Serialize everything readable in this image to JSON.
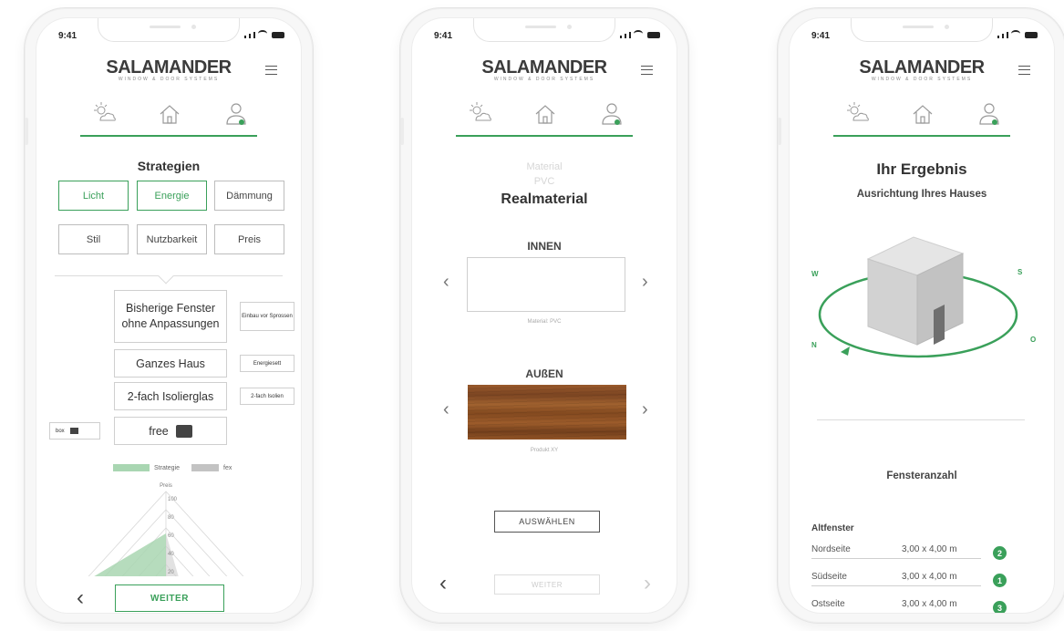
{
  "status": {
    "time": "9:41"
  },
  "brand": {
    "name": "SALAMANDER",
    "tagline": "WINDOW & DOOR SYSTEMS"
  },
  "icons": {
    "step1": "sun-cloud-icon",
    "step2": "house-icon",
    "step3": "user-icon",
    "menu": "hamburger-menu-icon"
  },
  "colors": {
    "accent": "#3aa05a",
    "wood": "#8a4f25"
  },
  "screen1": {
    "title": "Strategien",
    "strategies": [
      "Licht",
      "Energie",
      "Dämmung",
      "Stil",
      "Nutzbarkeit",
      "Preis"
    ],
    "active_strategies": [
      "Licht",
      "Energie"
    ],
    "cards": [
      "Bisherige Fenster ohne Anpassungen",
      "Ganzes Haus",
      "2-fach Isolierglas",
      "free"
    ],
    "side_cards": [
      "Einbau vor Sprossen",
      "Energiesett",
      "2-fach Isolien",
      "box"
    ],
    "legend": {
      "strategie": "Strategie",
      "other": "fex"
    },
    "radar_axis_label": "Preis",
    "radar_ticks": [
      "100",
      "80",
      "60",
      "40",
      "20"
    ],
    "next_label": "WEITER"
  },
  "screen2": {
    "faded_lines": [
      "Material",
      "PVC"
    ],
    "title": "Realmaterial",
    "inner_label": "INNEN",
    "inner_caption": "Material: PVC",
    "outer_label": "AUßEN",
    "outer_caption": "Produkt XY",
    "select_label": "AUSWÄHLEN",
    "next_label": "WEITER"
  },
  "screen3": {
    "title": "Ihr Ergebnis",
    "subtitle": "Ausrichtung Ihres Hauses",
    "compass": {
      "w": "W",
      "s": "S",
      "n": "N",
      "o": "O"
    },
    "section_title": "Fensteranzahl",
    "group_label": "Altfenster",
    "rows": [
      {
        "label": "Nordseite",
        "value": "3,00 x 4,00 m",
        "count": "2"
      },
      {
        "label": "Südseite",
        "value": "3,00 x 4,00 m",
        "count": "1"
      },
      {
        "label": "Ostseite",
        "value": "3,00 x 4,00 m",
        "count": "3"
      }
    ]
  }
}
